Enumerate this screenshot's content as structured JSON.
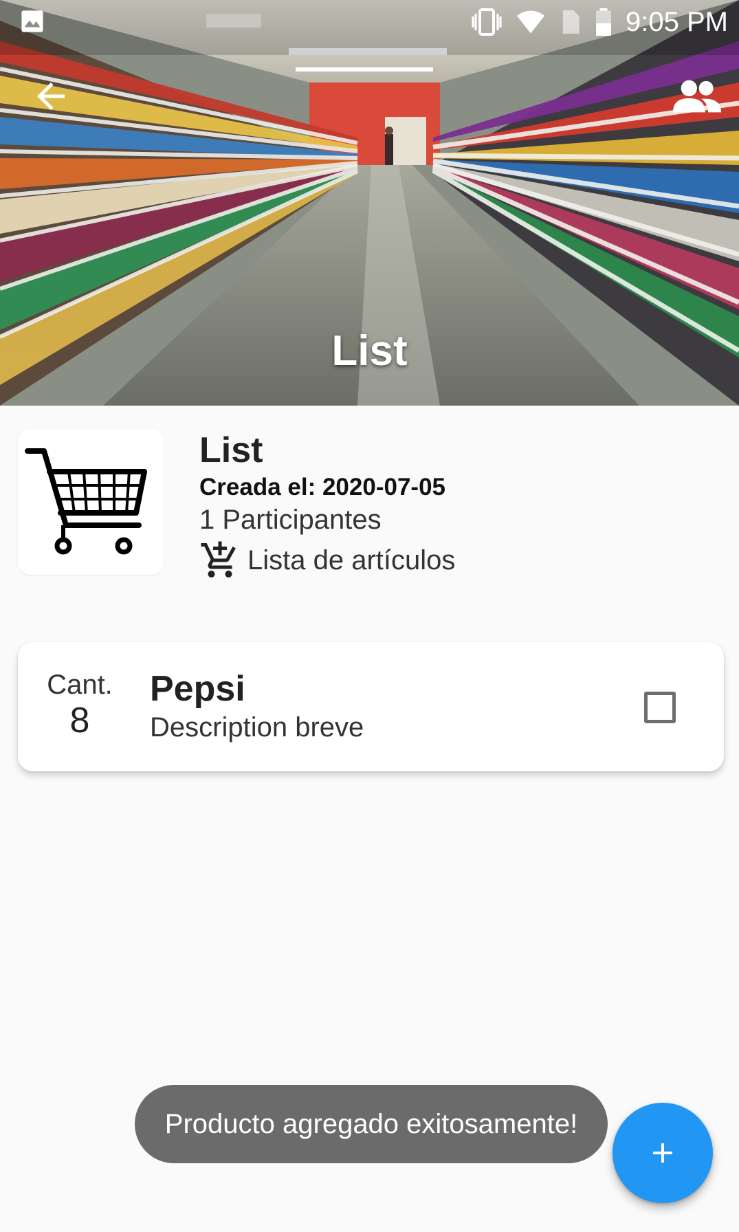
{
  "status_bar": {
    "time": "9:05 PM"
  },
  "appbar": {
    "title": "List",
    "back_icon": "arrow-back-icon",
    "action_icon": "people-icon"
  },
  "list": {
    "name": "List",
    "created": "Creada el: 2020-07-05",
    "participants": "1 Participantes",
    "items_link": "Lista de artículos",
    "thumbnail_icon": "shopping-cart-icon"
  },
  "items": [
    {
      "qty_label": "Cant.",
      "qty": "8",
      "name": "Pepsi",
      "description": "Description breve",
      "checked": false
    }
  ],
  "toast": {
    "message": "Producto agregado exitosamente!"
  },
  "fab": {
    "icon": "plus-icon"
  },
  "colors": {
    "accent": "#2196f3",
    "toast_bg": "#6b6b6b",
    "background": "#fafafa"
  }
}
